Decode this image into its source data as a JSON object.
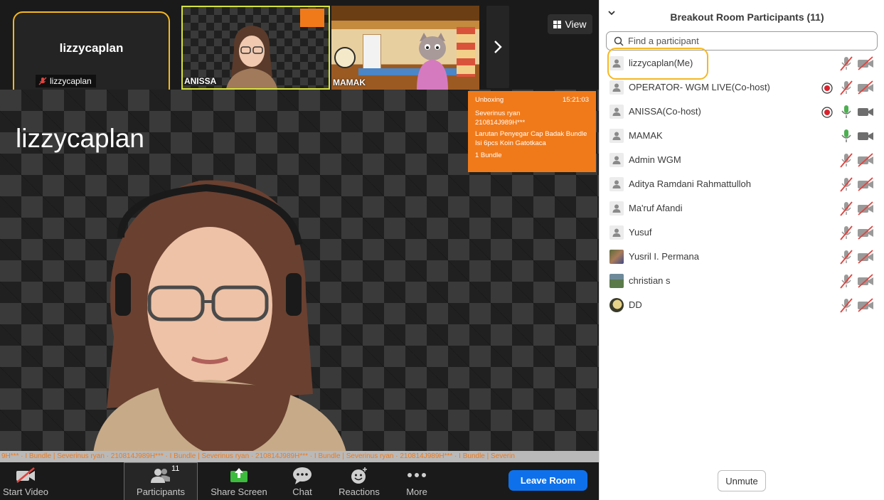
{
  "self_tile": {
    "name": "lizzycaplan",
    "label": "lizzycaplan"
  },
  "thumbnails": [
    {
      "label": "ANISSA"
    },
    {
      "label": "MAMAK"
    }
  ],
  "view_button": {
    "label": "View",
    "icon": "grid-icon"
  },
  "main_video": {
    "speaker_name": "lizzycaplan",
    "overlay": {
      "title": "Unboxing",
      "time": "15:21:03",
      "buyer": "Severinus ryan",
      "order": "210814J989H***",
      "product": "Larutan Penyegar Cap Badak Bundle Isi 6pcs Koin Gatotkaca",
      "qty": "1 Bundle"
    },
    "ticker": "9H*** · I Bundle  |  Severinus ryan · 210814J989H*** · I Bundle  |  Severinus ryan · 210814J989H*** · I Bundle  |  Severinus ryan · 210814J989H*** · I Bundle  |  Severin"
  },
  "toolbar": {
    "start_video": "Start Video",
    "participants": "Participants",
    "participants_count": "11",
    "share_screen": "Share Screen",
    "chat": "Chat",
    "reactions": "Reactions",
    "more": "More",
    "leave": "Leave Room"
  },
  "panel": {
    "title": "Breakout Room Participants (11)",
    "search_placeholder": "Find a participant",
    "unmute": "Unmute",
    "colors": {
      "accent_blue": "#0e71eb",
      "highlight": "#f5b820",
      "recording_red": "#d9232e",
      "mic_active": "#4caf50",
      "muted_red": "#e0433e"
    },
    "participants": [
      {
        "name": "lizzycaplan(Me)",
        "avatar": "default",
        "recording": false,
        "mic": "muted",
        "video": "off"
      },
      {
        "name": "OPERATOR- WGM LIVE(Co-host)",
        "avatar": "default",
        "recording": true,
        "mic": "muted",
        "video": "off"
      },
      {
        "name": "ANISSA(Co-host)",
        "avatar": "default",
        "recording": true,
        "mic": "on",
        "video": "on"
      },
      {
        "name": "MAMAK",
        "avatar": "default",
        "recording": false,
        "mic": "on",
        "video": "on"
      },
      {
        "name": "Admin WGM",
        "avatar": "default",
        "recording": false,
        "mic": "muted",
        "video": "off"
      },
      {
        "name": "Aditya Ramdani Rahmattulloh",
        "avatar": "default",
        "recording": false,
        "mic": "muted",
        "video": "off"
      },
      {
        "name": "Ma'ruf Afandi",
        "avatar": "default",
        "recording": false,
        "mic": "muted",
        "video": "off"
      },
      {
        "name": "Yusuf",
        "avatar": "default",
        "recording": false,
        "mic": "muted",
        "video": "off"
      },
      {
        "name": "Yusril I. Permana",
        "avatar": "photo1",
        "recording": false,
        "mic": "muted",
        "video": "off"
      },
      {
        "name": "christian s",
        "avatar": "photo2",
        "recording": false,
        "mic": "muted",
        "video": "off"
      },
      {
        "name": "DD",
        "avatar": "photo3",
        "recording": false,
        "mic": "muted",
        "video": "off"
      }
    ]
  }
}
